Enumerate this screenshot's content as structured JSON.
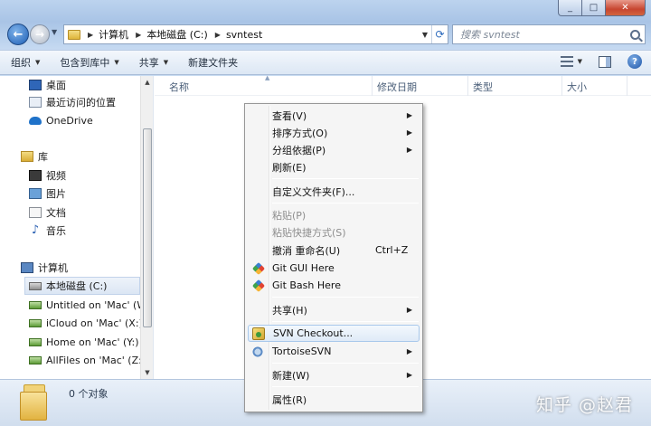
{
  "address": {
    "crumbs": [
      "计算机",
      "本地磁盘 (C:)",
      "svntest"
    ],
    "separator": "▶"
  },
  "search": {
    "placeholder": "搜索 svntest"
  },
  "toolbar": {
    "organize": "组织",
    "include_in_library": "包含到库中",
    "share": "共享",
    "new_folder": "新建文件夹"
  },
  "nav": {
    "items": [
      {
        "label": "桌面",
        "icon": "desktop-icon"
      },
      {
        "label": "最近访问的位置",
        "icon": "recent-places-icon"
      },
      {
        "label": "OneDrive",
        "icon": "onedrive-icon"
      },
      {
        "label": "库",
        "icon": "library-icon"
      },
      {
        "label": "视频",
        "icon": "video-icon"
      },
      {
        "label": "图片",
        "icon": "pictures-icon"
      },
      {
        "label": "文档",
        "icon": "documents-icon"
      },
      {
        "label": "音乐",
        "icon": "music-icon"
      },
      {
        "label": "计算机",
        "icon": "computer-icon"
      },
      {
        "label": "本地磁盘 (C:)",
        "icon": "local-disk-icon"
      },
      {
        "label": "Untitled on 'Mac' (W",
        "icon": "network-drive-icon"
      },
      {
        "label": "iCloud on 'Mac' (X:)",
        "icon": "network-drive-icon"
      },
      {
        "label": "Home on 'Mac' (Y:)",
        "icon": "network-drive-icon"
      },
      {
        "label": "AllFiles on 'Mac' (Z:)",
        "icon": "network-drive-icon"
      }
    ]
  },
  "columns": [
    "名称",
    "修改日期",
    "类型",
    "大小"
  ],
  "content": {
    "empty_fragment": "。"
  },
  "context_menu": {
    "items": [
      {
        "label": "查看(V)",
        "submenu": true
      },
      {
        "label": "排序方式(O)",
        "submenu": true
      },
      {
        "label": "分组依据(P)",
        "submenu": true
      },
      {
        "label": "刷新(E)"
      },
      {
        "label": "自定义文件夹(F)..."
      },
      {
        "label": "粘贴(P)",
        "disabled": true
      },
      {
        "label": "粘贴快捷方式(S)",
        "disabled": true
      },
      {
        "label": "撤消 重命名(U)",
        "shortcut": "Ctrl+Z"
      },
      {
        "label": "Git GUI Here",
        "icon": "git-gui-icon"
      },
      {
        "label": "Git Bash Here",
        "icon": "git-bash-icon"
      },
      {
        "label": "共享(H)",
        "submenu": true
      },
      {
        "label": "SVN Checkout...",
        "icon": "svn-checkout-icon",
        "highlighted": true
      },
      {
        "label": "TortoiseSVN",
        "icon": "tortoisesvn-icon",
        "submenu": true
      },
      {
        "label": "新建(W)",
        "submenu": true
      },
      {
        "label": "属性(R)"
      }
    ]
  },
  "status": {
    "count": "0 个对象"
  },
  "watermark": "知乎 @赵君"
}
